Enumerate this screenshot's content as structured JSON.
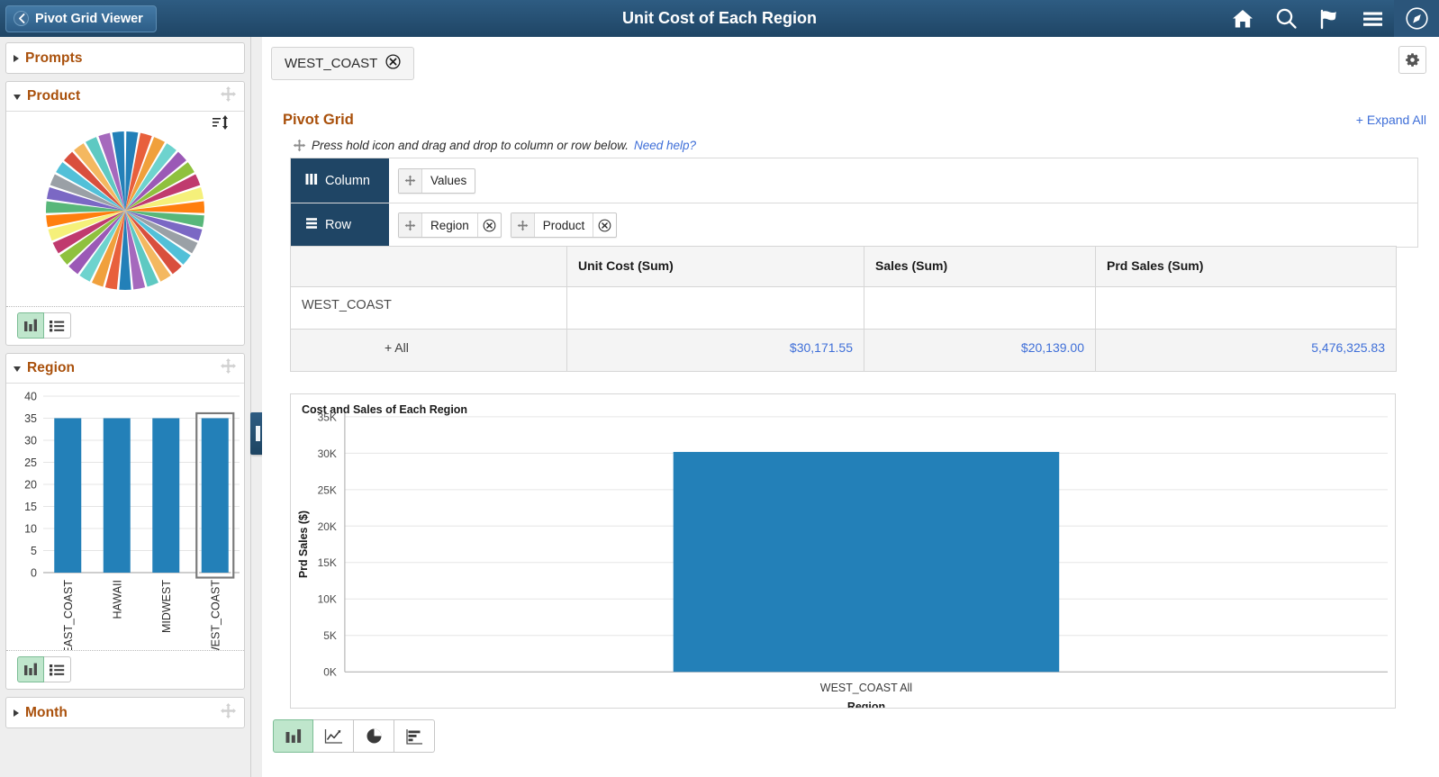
{
  "header": {
    "back_label": "Pivot Grid Viewer",
    "title": "Unit Cost of Each Region",
    "icons": [
      "home-icon",
      "search-icon",
      "flag-icon",
      "menu-icon",
      "nav-compass-icon"
    ]
  },
  "sidebar": {
    "panels": [
      {
        "title": "Prompts",
        "state": "collapsed"
      },
      {
        "title": "Product",
        "state": "expanded",
        "chart_type": "pie"
      },
      {
        "title": "Region",
        "state": "expanded",
        "chart_type": "bar"
      },
      {
        "title": "Month",
        "state": "collapsed"
      }
    ],
    "view_toggle": {
      "chart_label": "chart-view-icon",
      "list_label": "list-view-icon",
      "active": "chart"
    }
  },
  "filter": {
    "chips": [
      {
        "label": "WEST_COAST",
        "remove_icon": "remove-circle-icon"
      }
    ],
    "gear_icon": "gear-icon"
  },
  "pivot": {
    "title": "Pivot Grid",
    "expand_all": "+ Expand All",
    "hint": "Press hold icon and drag and drop to column or row below.",
    "need_help": "Need help?",
    "column_zone": {
      "label": "Column",
      "icon": "columns-icon",
      "items": [
        {
          "label": "Values",
          "removable": false
        }
      ]
    },
    "row_zone": {
      "label": "Row",
      "icon": "rows-icon",
      "items": [
        {
          "label": "Region",
          "removable": true
        },
        {
          "label": "Product",
          "removable": true
        }
      ]
    }
  },
  "table": {
    "headers": [
      "",
      "Unit Cost (Sum)",
      "Sales (Sum)",
      "Prd Sales (Sum)"
    ],
    "rows": [
      {
        "label": "WEST_COAST",
        "indent": false,
        "values": [
          "",
          "",
          ""
        ],
        "total": false
      },
      {
        "label": "+ All",
        "indent": true,
        "values": [
          "$30,171.55",
          "$20,139.00",
          "5,476,325.83"
        ],
        "total": true
      }
    ]
  },
  "chart_data": {
    "type": "bar",
    "title": "Cost and Sales of Each Region",
    "xlabel": "Region",
    "ylabel": "Prd Sales ($)",
    "categories": [
      "WEST_COAST All"
    ],
    "values": [
      30171.55
    ],
    "ylim": [
      0,
      35000
    ],
    "yticks": [
      0,
      5000,
      10000,
      15000,
      20000,
      25000,
      30000,
      35000
    ],
    "ytick_labels": [
      "0K",
      "5K",
      "10K",
      "15K",
      "20K",
      "25K",
      "30K",
      "35K"
    ],
    "series": [
      {
        "name": "Unit Cost (Sum)",
        "values": [
          30171.55
        ],
        "color": "#2380b8"
      }
    ],
    "grid": true,
    "legend": "none"
  },
  "sidebar_charts": {
    "product": {
      "type": "pie",
      "title": "Product",
      "slice_count": 35,
      "equal_slices": true,
      "palette": [
        "#2380b8",
        "#e8603c",
        "#f0a03c",
        "#6ed3ce",
        "#9b59b6",
        "#8fc13e",
        "#c03a6e",
        "#f5f07a",
        "#ff7f0e",
        "#58b77a",
        "#7b68c4",
        "#9aa0a6",
        "#52c0d8",
        "#d94f3d",
        "#f4b860",
        "#5ec9c2",
        "#a569bd"
      ]
    },
    "region": {
      "type": "bar",
      "categories": [
        "EAST_COAST",
        "HAWAII",
        "MIDWEST",
        "WEST_COAST"
      ],
      "values": [
        35,
        35,
        35,
        35
      ],
      "ylim": [
        0,
        40
      ],
      "yticks": [
        0,
        5,
        10,
        15,
        20,
        25,
        30,
        35,
        40
      ],
      "selected": "WEST_COAST",
      "color": "#2380b8"
    }
  },
  "chart_toolbar": {
    "buttons": [
      "bar-chart-icon",
      "line-chart-icon",
      "pie-chart-icon",
      "horizontal-bar-chart-icon"
    ],
    "active_index": 0
  },
  "colors": {
    "header_bg": "#1f4565",
    "accent_orange": "#a9500b",
    "link_blue": "#3f6fd8",
    "bar_blue": "#2380b8",
    "active_green": "#bfe6cc"
  }
}
